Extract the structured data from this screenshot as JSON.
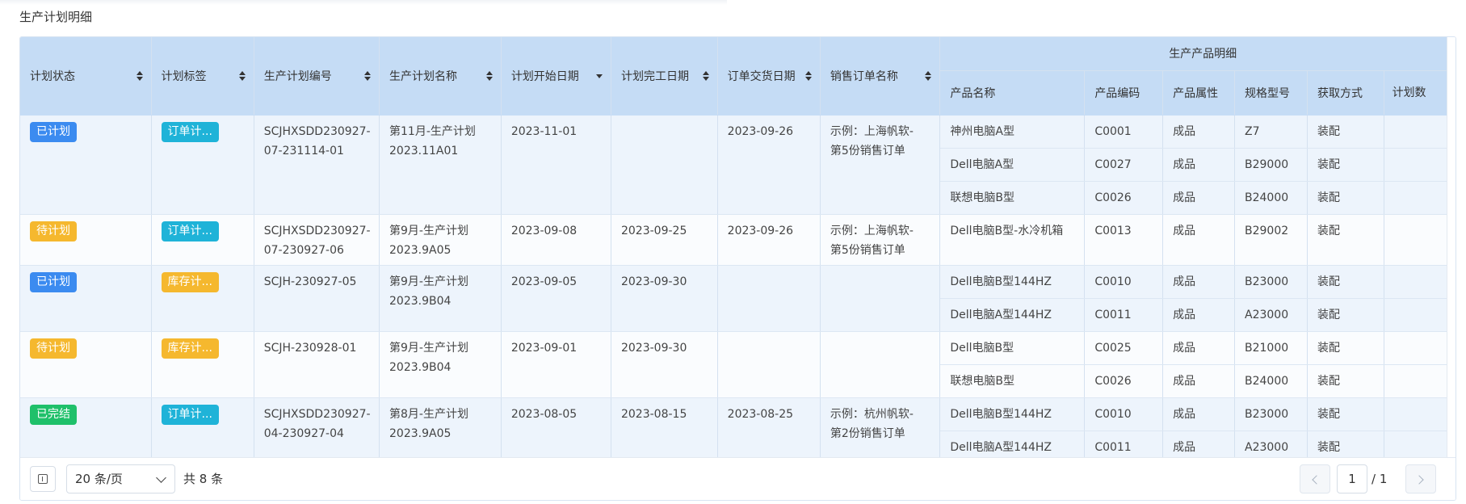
{
  "page_title": "生产计划明细",
  "columns": {
    "status": "计划状态",
    "tag": "计划标签",
    "plan_no": "生产计划编号",
    "plan_name": "生产计划名称",
    "start_date": "计划开始日期",
    "end_date": "计划完工日期",
    "delivery_date": "订单交货日期",
    "sales_order": "销售订单名称",
    "group": "生产产品明细",
    "product_name": "产品名称",
    "product_code": "产品编码",
    "product_attr": "产品属性",
    "spec": "规格型号",
    "acquire": "获取方式",
    "qty_partial": "计划数"
  },
  "rows": [
    {
      "status": "已计划",
      "status_color": "#3b8bf0",
      "tag": "订单计...",
      "tag_color": "#1fb3d8",
      "plan_no": "SCJHXSDD230927-07-231114-01",
      "plan_no_l1": "SCJHXSDD230927-",
      "plan_no_l2": "07-231114-01",
      "plan_name_l1": "第11月-生产计划",
      "plan_name_l2": "2023.11A01",
      "start_date": "2023-11-01",
      "end_date": "",
      "delivery_date": "2023-09-26",
      "sales_l1": "示例：上海帆软-",
      "sales_l2": "第5份销售订单",
      "products": [
        {
          "name": "神州电脑A型",
          "code": "C0001",
          "attr": "成品",
          "spec": "Z7",
          "acquire": "装配"
        },
        {
          "name": "Dell电脑A型",
          "code": "C0027",
          "attr": "成品",
          "spec": "B29000",
          "acquire": "装配"
        },
        {
          "name": "联想电脑B型",
          "code": "C0026",
          "attr": "成品",
          "spec": "B24000",
          "acquire": "装配"
        }
      ]
    },
    {
      "status": "待计划",
      "status_color": "#f5b82e",
      "tag": "订单计...",
      "tag_color": "#1fb3d8",
      "plan_no_l1": "SCJHXSDD230927-",
      "plan_no_l2": "07-230927-06",
      "plan_name_l1": "第9月-生产计划",
      "plan_name_l2": "2023.9A05",
      "start_date": "2023-09-08",
      "end_date": "2023-09-25",
      "delivery_date": "2023-09-26",
      "sales_l1": "示例：上海帆软-",
      "sales_l2": "第5份销售订单",
      "products": [
        {
          "name": "Dell电脑B型-水冷机箱",
          "code": "C0013",
          "attr": "成品",
          "spec": "B29002",
          "acquire": "装配"
        }
      ]
    },
    {
      "status": "已计划",
      "status_color": "#3b8bf0",
      "tag": "库存计...",
      "tag_color": "#f5b82e",
      "plan_no_l1": "SCJH-230927-05",
      "plan_no_l2": "",
      "plan_name_l1": "第9月-生产计划",
      "plan_name_l2": "2023.9B04",
      "start_date": "2023-09-05",
      "end_date": "2023-09-30",
      "delivery_date": "",
      "sales_l1": "",
      "sales_l2": "",
      "products": [
        {
          "name": "Dell电脑B型144HZ",
          "code": "C0010",
          "attr": "成品",
          "spec": "B23000",
          "acquire": "装配"
        },
        {
          "name": "Dell电脑A型144HZ",
          "code": "C0011",
          "attr": "成品",
          "spec": "A23000",
          "acquire": "装配"
        }
      ]
    },
    {
      "status": "待计划",
      "status_color": "#f5b82e",
      "tag": "库存计...",
      "tag_color": "#f5b82e",
      "plan_no_l1": "SCJH-230928-01",
      "plan_no_l2": "",
      "plan_name_l1": "第9月-生产计划",
      "plan_name_l2": "2023.9B04",
      "start_date": "2023-09-01",
      "end_date": "2023-09-30",
      "delivery_date": "",
      "sales_l1": "",
      "sales_l2": "",
      "products": [
        {
          "name": "Dell电脑B型",
          "code": "C0025",
          "attr": "成品",
          "spec": "B21000",
          "acquire": "装配"
        },
        {
          "name": "联想电脑B型",
          "code": "C0026",
          "attr": "成品",
          "spec": "B24000",
          "acquire": "装配"
        }
      ]
    },
    {
      "status": "已完结",
      "status_color": "#1fc06a",
      "tag": "订单计...",
      "tag_color": "#1fb3d8",
      "plan_no_l1": "SCJHXSDD230927-",
      "plan_no_l2": "04-230927-04",
      "plan_name_l1": "第8月-生产计划",
      "plan_name_l2": "2023.9A05",
      "start_date": "2023-08-05",
      "end_date": "2023-08-15",
      "delivery_date": "2023-08-25",
      "sales_l1": "示例：杭州帆软-",
      "sales_l2": "第2份销售订单",
      "products": [
        {
          "name": "Dell电脑B型144HZ",
          "code": "C0010",
          "attr": "成品",
          "spec": "B23000",
          "acquire": "装配"
        },
        {
          "name": "Dell电脑A型144HZ",
          "code": "C0011",
          "attr": "成品",
          "spec": "A23000",
          "acquire": "装配"
        }
      ]
    }
  ],
  "footer": {
    "page_size": "20 条/页",
    "total": "共 8 条",
    "current_page": "1",
    "page_count": "/ 1"
  }
}
